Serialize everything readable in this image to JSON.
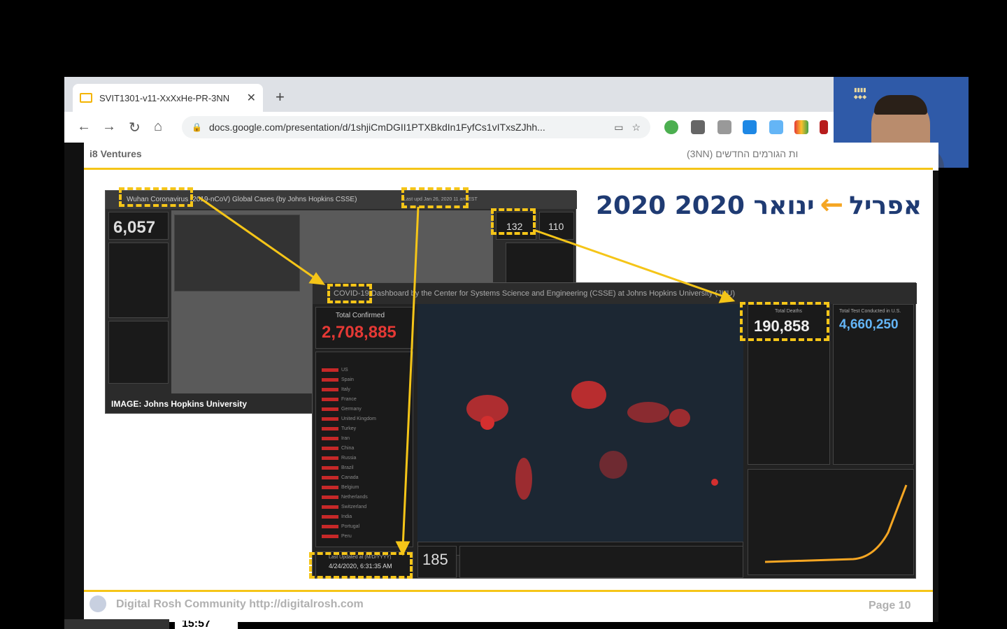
{
  "browser": {
    "tab_title": "SVIT1301-v11-XxXxHe-PR-3NN",
    "url": "docs.google.com/presentation/d/1shjiCmDGII1PTXBkdIn1FyfCs1vITxsZJhh...",
    "new_tab_label": "+"
  },
  "slide": {
    "brand": "i8 Ventures",
    "hebrew_subtitle": "(3NN) ות הגורמים החדשים",
    "title_left": "2020 אפריל",
    "title_right": "ינואר 2020",
    "title_arrow": "←",
    "footer_text": "Digital Rosh Community  http://digitalrosh.com",
    "page_label": "Page 10"
  },
  "old_dashboard": {
    "header": "Wuhan Coronavirus (2019-nCoV) Global Cases (by Johns Hopkins CSSE)",
    "last_updated": "Last upd Jan 26, 2020 11 am EST",
    "total_confirmed": "6,057",
    "stat_1": "132",
    "stat_2": "110",
    "caption": "IMAGE: Johns Hopkins University"
  },
  "new_dashboard": {
    "header": "COVID-19 Dashboard by the Center for Systems Science and Engineering (CSSE) at Johns Hopkins University (JHU)",
    "total_confirmed_label": "Total Confirmed",
    "total_confirmed": "2,708,885",
    "total_deaths_label": "Total Deaths",
    "total_deaths": "190,858",
    "total_tests_label": "Total Test Conducted in U.S.",
    "total_tests": "4,660,250",
    "countries_count": "185",
    "last_updated_label": "Last Updated at (M/D/YYYY)",
    "last_updated": "4/24/2020, 6:31:35 AM",
    "countries": [
      "US",
      "Spain",
      "Italy",
      "France",
      "Germany",
      "United Kingdom",
      "Turkey",
      "Iran",
      "China",
      "Russia",
      "Brazil",
      "Canada",
      "Belgium",
      "Netherlands",
      "Switzerland",
      "India",
      "Portugal",
      "Peru"
    ]
  },
  "clock": "15:57",
  "colors": {
    "accent": "#f5c518",
    "title": "#1f3b73",
    "alert": "#e53935"
  }
}
